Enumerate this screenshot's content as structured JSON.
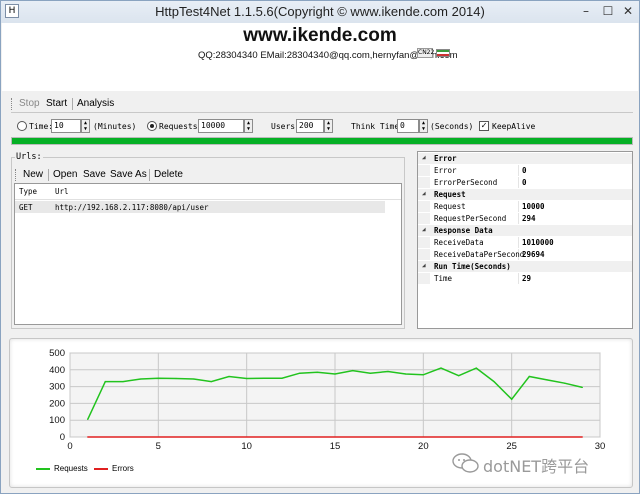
{
  "window": {
    "title": "HttpTest4Net 1.1.5.6(Copyright © www.ikende.com  2014)",
    "app_icon": "H",
    "controls": {
      "minimize": "–",
      "maximize": "☐",
      "close": "✕"
    }
  },
  "header": {
    "brand": "www.ikende.com",
    "contact": "QQ:28304340 EMail:28304340@qq.com,hernyfan@msn.com",
    "language": "CN22"
  },
  "toolbar": {
    "stop": "Stop",
    "start": "Start",
    "analysis": "Analysis"
  },
  "options": {
    "time_label": "Time:",
    "time_value": "10",
    "time_unit": "(Minutes)",
    "time_selected": false,
    "requests_label": "Requests:",
    "requests_value": "10000",
    "requests_selected": true,
    "users_label": "Users:",
    "users_value": "200",
    "think_label": "Think Time:",
    "think_value": "0",
    "think_unit": "(Seconds)",
    "keepalive_label": "KeepAlive",
    "keepalive_checked": true
  },
  "progress": {
    "value": 1.0,
    "color": "#06b025"
  },
  "urls": {
    "legend": "Urls:",
    "toolbar": {
      "new": "New",
      "open": "Open",
      "save": "Save",
      "save_as": "Save As",
      "delete": "Delete"
    },
    "columns": [
      "Type",
      "Url"
    ],
    "rows": [
      {
        "type": "GET",
        "url": "http://192.168.2.117:8080/api/user"
      }
    ]
  },
  "properties": {
    "categories": [
      {
        "name": "Error",
        "items": [
          {
            "key": "Error",
            "value": "0"
          },
          {
            "key": "ErrorPerSecond",
            "value": "0"
          }
        ]
      },
      {
        "name": "Request",
        "items": [
          {
            "key": "Request",
            "value": "10000"
          },
          {
            "key": "RequestPerSecond",
            "value": "294"
          }
        ]
      },
      {
        "name": "Response Data",
        "items": [
          {
            "key": "ReceiveData",
            "value": "1010000"
          },
          {
            "key": "ReceiveDataPerSecond",
            "value": "29694"
          }
        ]
      },
      {
        "name": "Run Time(Seconds)",
        "items": [
          {
            "key": "Time",
            "value": "29"
          }
        ]
      }
    ]
  },
  "chart_data": {
    "type": "line",
    "x_ticks": [
      0,
      5,
      10,
      15,
      20,
      25,
      30
    ],
    "y_ticks": [
      0,
      100,
      200,
      300,
      400,
      500
    ],
    "xlim": [
      0,
      30
    ],
    "ylim": [
      0,
      500
    ],
    "grid": true,
    "legend_placement": "bottom-left",
    "series": [
      {
        "name": "Requests",
        "color": "#22c31e",
        "x": [
          1,
          2,
          3,
          4,
          5,
          6,
          7,
          8,
          9,
          10,
          11,
          12,
          13,
          14,
          15,
          16,
          17,
          18,
          19,
          20,
          21,
          22,
          23,
          24,
          25,
          26,
          27,
          28,
          29
        ],
        "y": [
          105,
          330,
          330,
          345,
          350,
          348,
          345,
          330,
          360,
          348,
          350,
          350,
          380,
          385,
          375,
          395,
          380,
          390,
          375,
          370,
          410,
          365,
          410,
          330,
          225,
          360,
          340,
          320,
          295
        ]
      },
      {
        "name": "Errors",
        "color": "#e02020",
        "x": [
          1,
          29
        ],
        "y": [
          0,
          0
        ]
      }
    ]
  },
  "watermark": {
    "text": "dotNET跨平台"
  }
}
